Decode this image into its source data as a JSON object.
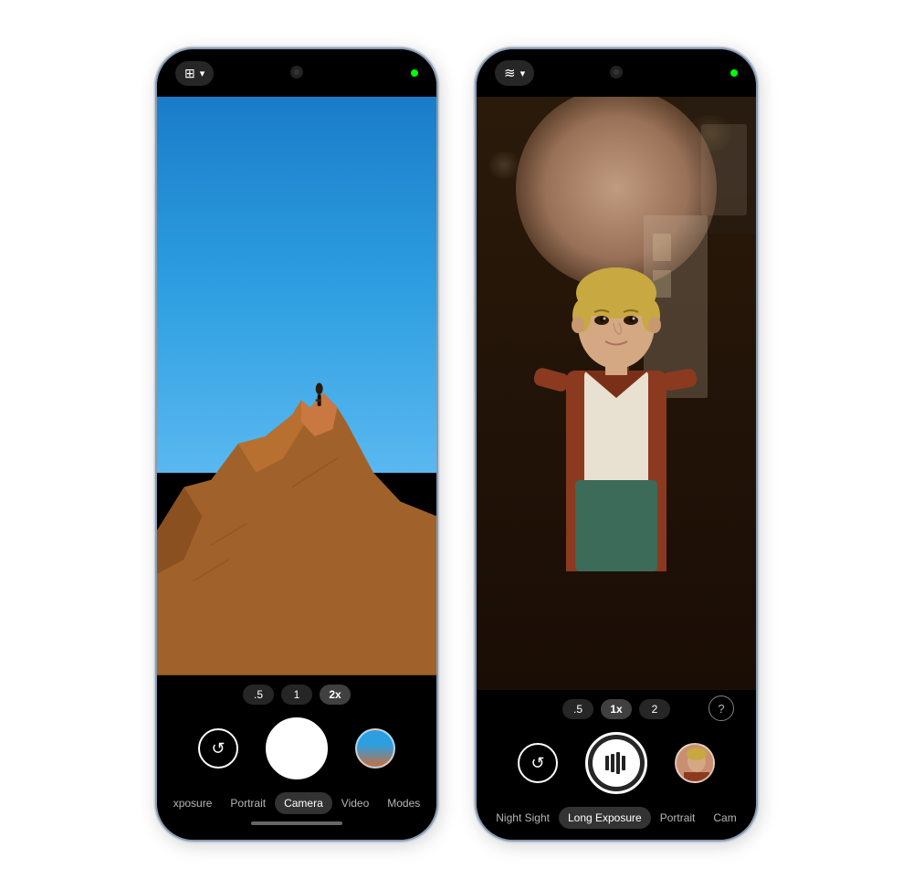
{
  "phones": [
    {
      "id": "left",
      "mode_label": "Camera",
      "mode_icon": "📷",
      "zoom_options": [
        ".5",
        "1",
        "2x"
      ],
      "active_zoom": "2x",
      "modes": [
        "xposure",
        "Portrait",
        "Camera",
        "Video",
        "Modes"
      ],
      "active_mode": "Camera",
      "shutter_type": "standard",
      "has_home_indicator": true,
      "status_green": true
    },
    {
      "id": "right",
      "mode_label": "Night Sight",
      "mode_icon": "📊",
      "zoom_options": [
        ".5",
        "1x",
        "2"
      ],
      "active_zoom": "1x",
      "modes": [
        "Night Sight",
        "Long Exposure",
        "Portrait",
        "Cam"
      ],
      "active_mode": "Long Exposure",
      "shutter_type": "longexposure",
      "has_home_indicator": false,
      "has_help": true,
      "status_green": true
    }
  ],
  "left_phone": {
    "top_mode": "Camera mode",
    "zoom": {
      "options": [
        ".5",
        "1",
        "2x"
      ],
      "active": 2
    },
    "modes_strip": {
      "items": [
        "xposure",
        "Portrait",
        "Camera",
        "Video",
        "Modes"
      ],
      "active": 2
    }
  },
  "right_phone": {
    "top_mode": "Night Sight mode",
    "zoom": {
      "options": [
        ".5",
        "1x",
        "2"
      ],
      "active": 1
    },
    "modes_strip": {
      "items": [
        "Night Sight",
        "Long Exposure",
        "Portrait",
        "Cam"
      ],
      "active": 1
    }
  }
}
